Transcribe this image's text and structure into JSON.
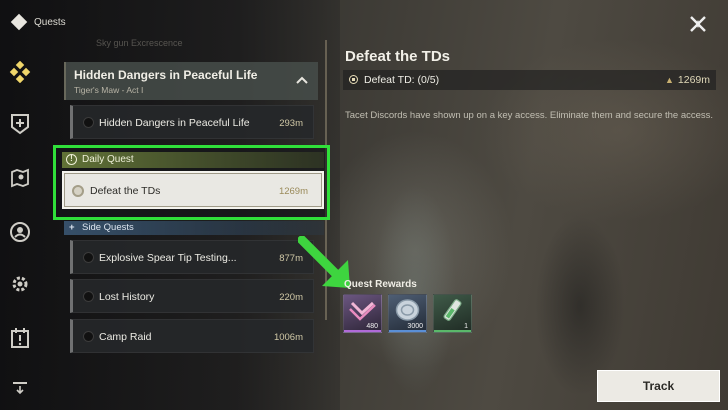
{
  "header": {
    "title": "Quests",
    "logo_icon": "quest-diamond-icon",
    "close_icon": "close-x-icon"
  },
  "sidebar": {
    "items": [
      {
        "icon": "quest-diamond-icon",
        "active": true
      },
      {
        "icon": "shield-plus-icon"
      },
      {
        "icon": "map-pin-icon"
      },
      {
        "icon": "companion-icon"
      },
      {
        "icon": "gear-icon"
      },
      {
        "icon": "calendar-alert-icon"
      },
      {
        "icon": "download-icon"
      }
    ]
  },
  "quest_list": {
    "faded_item": "Sky gun Excrescence",
    "group": {
      "title": "Hidden Dangers in Peaceful Life",
      "subtitle": "Tiger's Maw - Act I",
      "expanded": true,
      "items": [
        {
          "name": "Hidden Dangers in Peaceful Life",
          "distance": "293m"
        }
      ]
    },
    "daily": {
      "label": "Daily Quest",
      "item": {
        "name": "Defeat the TDs",
        "distance": "1269m",
        "selected": true
      }
    },
    "side": {
      "label": "Side Quests",
      "items": [
        {
          "name": "Explosive Spear Tip Testing...",
          "distance": "877m"
        },
        {
          "name": "Lost History",
          "distance": "220m"
        },
        {
          "name": "Camp Raid",
          "distance": "1006m"
        }
      ]
    }
  },
  "detail": {
    "title": "Defeat the TDs",
    "objective": "Defeat TD: (0/5)",
    "objective_distance": "1269m",
    "description": "Tacet Discords have shown up on a key access. Eliminate them and secure the access.",
    "rewards_heading": "Quest Rewards",
    "rewards": [
      {
        "icon": "union-exp-icon",
        "count": "480",
        "accent": "#b06ad8"
      },
      {
        "icon": "shell-credit-icon",
        "count": "3000",
        "accent": "#5a8fd6"
      },
      {
        "icon": "potion-vial-icon",
        "count": "1",
        "accent": "#5ab86a"
      }
    ],
    "track_label": "Track"
  },
  "colors": {
    "highlight_frame": "#30e03a",
    "arrow": "#3ed53f"
  }
}
